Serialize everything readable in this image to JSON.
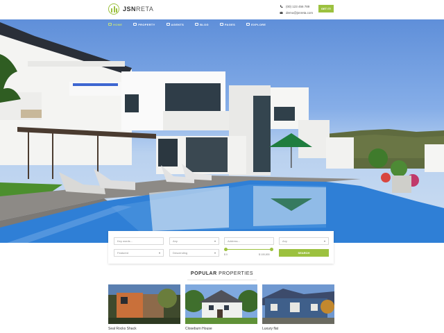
{
  "brand": {
    "name_bold": "JSN",
    "name_light": "RETA"
  },
  "contact": {
    "phone": "(00) 123 456 789",
    "email": "demo@jsnreta.com"
  },
  "header": {
    "cta_label": "GET IT!"
  },
  "nav": [
    {
      "label": "HOME",
      "icon": "home-icon",
      "active": true
    },
    {
      "label": "PROPERTY",
      "icon": "building-icon",
      "active": false
    },
    {
      "label": "AGENTS",
      "icon": "person-icon",
      "active": false
    },
    {
      "label": "BLOG",
      "icon": "document-icon",
      "active": false
    },
    {
      "label": "PAGES",
      "icon": "pages-icon",
      "active": false
    },
    {
      "label": "EXPLORE",
      "icon": "compass-icon",
      "active": false
    }
  ],
  "search": {
    "keyword_placeholder": "Key words...",
    "type_value": "Any",
    "address_placeholder": "Address...",
    "location_value": "Any",
    "sort_value": "Featured",
    "order_value": "Descending",
    "price_min": "$ 0",
    "price_max": "$ 100,000",
    "button_label": "SEARCH"
  },
  "popular": {
    "title_bold": "POPULAR",
    "title_light": " PROPERTIES",
    "items": [
      {
        "name": "Seal Rocks Shack"
      },
      {
        "name": "Closeburn House"
      },
      {
        "name": "Luxury flat"
      }
    ]
  },
  "colors": {
    "accent": "#9cc13f",
    "pool": "#2f7fd6",
    "sky": "#6f9ce2"
  }
}
